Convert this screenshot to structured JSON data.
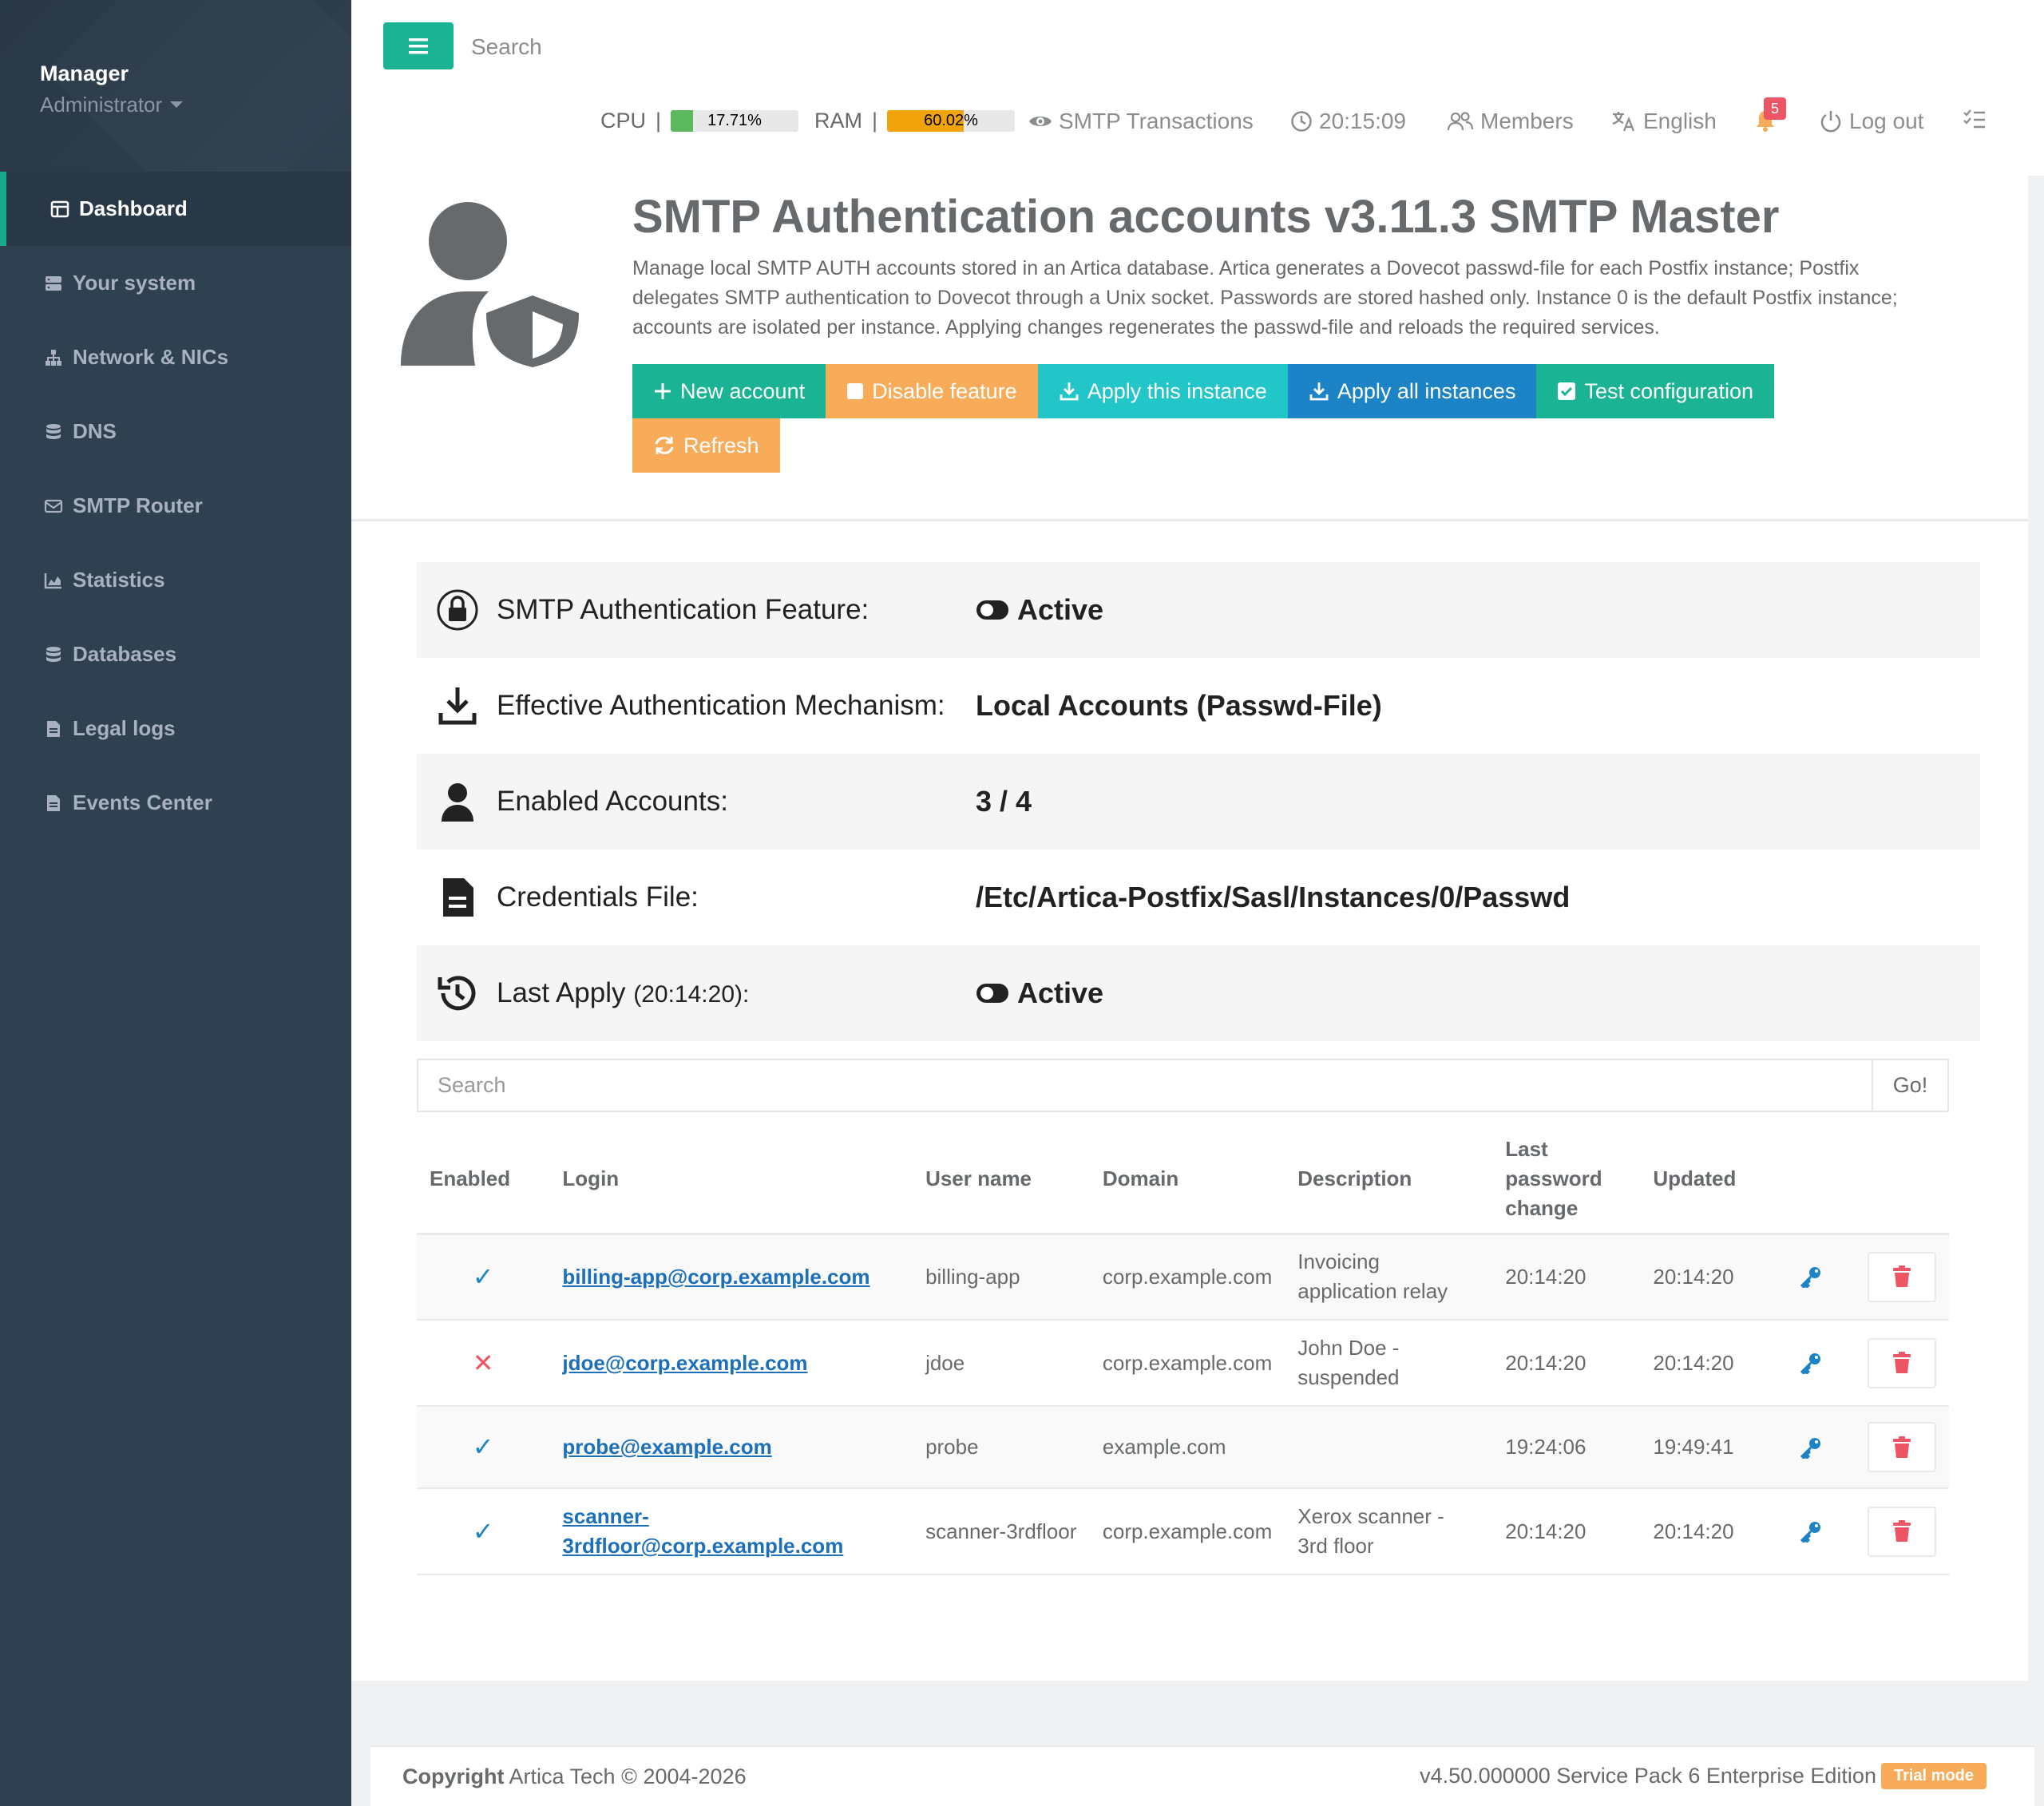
{
  "sidebar": {
    "profile_name": "Manager",
    "profile_role": "Administrator",
    "items": [
      {
        "label": "Dashboard",
        "icon": "dashboard-icon"
      },
      {
        "label": "Your system",
        "icon": "server-icon"
      },
      {
        "label": "Network & NICs",
        "icon": "network-icon"
      },
      {
        "label": "DNS",
        "icon": "database-icon"
      },
      {
        "label": "SMTP Router",
        "icon": "envelope-icon"
      },
      {
        "label": "Statistics",
        "icon": "chart-icon"
      },
      {
        "label": "Databases",
        "icon": "database-icon"
      },
      {
        "label": "Legal logs",
        "icon": "file-icon"
      },
      {
        "label": "Events Center",
        "icon": "file-icon"
      }
    ]
  },
  "topbar": {
    "search_placeholder": "Search",
    "cpu_label": "CPU",
    "cpu_value": "17.71%",
    "cpu_fraction": 0.1771,
    "ram_label": "RAM",
    "ram_value": "60.02%",
    "ram_fraction": 0.6002,
    "smtp_transactions": "SMTP Transactions",
    "clock": "20:15:09",
    "members": "Members",
    "language": "English",
    "notifications_count": "5",
    "logout": "Log out",
    "colors": {
      "cpu": "#5cb85c",
      "ram": "#f0a30a",
      "accent": "#1ab394"
    }
  },
  "page": {
    "title": "SMTP Authentication accounts v3.11.3 SMTP Master",
    "description": "Manage local SMTP AUTH accounts stored in an Artica database. Artica generates a Dovecot passwd-file for each Postfix instance; Postfix delegates SMTP authentication to Dovecot through a Unix socket. Passwords are stored hashed only. Instance 0 is the default Postfix instance; accounts are isolated per instance. Applying changes regenerates the passwd-file and reloads the required services.",
    "buttons": {
      "new_account": "New account",
      "disable_feature": "Disable feature",
      "apply_instance": "Apply this instance",
      "apply_all": "Apply all instances",
      "test_config": "Test configuration",
      "refresh": "Refresh"
    }
  },
  "info": {
    "feature_label": "SMTP Authentication Feature:",
    "feature_value": "Active",
    "mechanism_label": "Effective Authentication Mechanism:",
    "mechanism_value": "Local Accounts (Passwd-File)",
    "enabled_label": "Enabled Accounts:",
    "enabled_value": "3 / 4",
    "cred_label": "Credentials File:",
    "cred_value": "/Etc/Artica-Postfix/Sasl/Instances/0/Passwd",
    "apply_label": "Last Apply",
    "apply_time": "(20:14:20):",
    "apply_value": "Active"
  },
  "table": {
    "search_placeholder": "Search",
    "go_label": "Go!",
    "headers": {
      "enabled": "Enabled",
      "login": "Login",
      "username": "User name",
      "domain": "Domain",
      "description": "Description",
      "last_pw": "Last password change",
      "updated": "Updated"
    },
    "rows": [
      {
        "enabled": "✓",
        "login": "billing-app@corp.example.com",
        "username": "billing-app",
        "domain": "corp.example.com",
        "description": "Invoicing application relay",
        "last_pw": "20:14:20",
        "updated": "20:14:20"
      },
      {
        "enabled": "✕",
        "login": "jdoe@corp.example.com",
        "username": "jdoe",
        "domain": "corp.example.com",
        "description": "John Doe - suspended",
        "last_pw": "20:14:20",
        "updated": "20:14:20"
      },
      {
        "enabled": "✓",
        "login": "probe@example.com",
        "username": "probe",
        "domain": "example.com",
        "description": "",
        "last_pw": "19:24:06",
        "updated": "19:49:41"
      },
      {
        "enabled": "✓",
        "login": "scanner-3rdfloor@corp.example.com",
        "username": "scanner-3rdfloor",
        "domain": "corp.example.com",
        "description": "Xerox scanner - 3rd floor",
        "last_pw": "20:14:20",
        "updated": "20:14:20"
      }
    ]
  },
  "footer": {
    "copyright_label": "Copyright",
    "copyright_text": "Artica Tech © 2004-2026",
    "version": "v4.50.000000 Service Pack 6 Enterprise Edition",
    "trial": "Trial mode"
  }
}
